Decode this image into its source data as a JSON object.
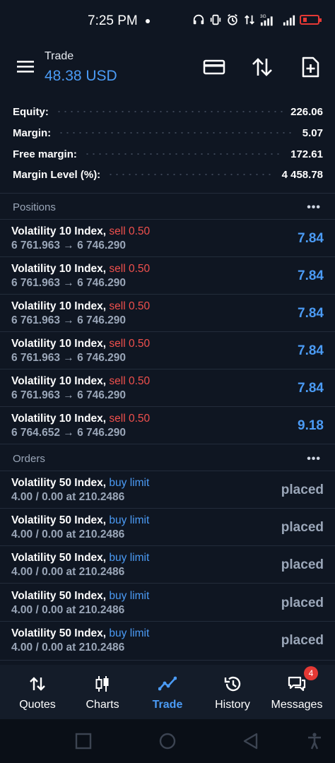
{
  "status_bar": {
    "time": "7:25 PM",
    "network": "3G",
    "battery_icon": "battery-low-icon"
  },
  "app_bar": {
    "title": "Trade",
    "balance": "48.38 USD"
  },
  "summary": {
    "rows": [
      {
        "label": "Equity:",
        "value": "226.06"
      },
      {
        "label": "Margin:",
        "value": "5.07"
      },
      {
        "label": "Free margin:",
        "value": "172.61"
      },
      {
        "label": "Margin Level (%):",
        "value": "4 458.78"
      }
    ]
  },
  "positions": {
    "header": "Positions",
    "more": "•••",
    "items": [
      {
        "symbol": "Volatility 10 Index,",
        "action": "sell 0.50",
        "prices": "6 761.963 → 6 746.290",
        "profit": "7.84"
      },
      {
        "symbol": "Volatility 10 Index,",
        "action": "sell 0.50",
        "prices": "6 761.963 → 6 746.290",
        "profit": "7.84"
      },
      {
        "symbol": "Volatility 10 Index,",
        "action": "sell 0.50",
        "prices": "6 761.963 → 6 746.290",
        "profit": "7.84"
      },
      {
        "symbol": "Volatility 10 Index,",
        "action": "sell 0.50",
        "prices": "6 761.963 → 6 746.290",
        "profit": "7.84"
      },
      {
        "symbol": "Volatility 10 Index,",
        "action": "sell 0.50",
        "prices": "6 761.963 → 6 746.290",
        "profit": "7.84"
      },
      {
        "symbol": "Volatility 10 Index,",
        "action": "sell 0.50",
        "prices": "6 764.652 → 6 746.290",
        "profit": "9.18"
      }
    ]
  },
  "orders": {
    "header": "Orders",
    "more": "•••",
    "items": [
      {
        "symbol": "Volatility 50 Index,",
        "action": "buy limit",
        "details": "4.00 / 0.00 at 210.2486",
        "state": "placed"
      },
      {
        "symbol": "Volatility 50 Index,",
        "action": "buy limit",
        "details": "4.00 / 0.00 at 210.2486",
        "state": "placed"
      },
      {
        "symbol": "Volatility 50 Index,",
        "action": "buy limit",
        "details": "4.00 / 0.00 at 210.2486",
        "state": "placed"
      },
      {
        "symbol": "Volatility 50 Index,",
        "action": "buy limit",
        "details": "4.00 / 0.00 at 210.2486",
        "state": "placed"
      },
      {
        "symbol": "Volatility 50 Index,",
        "action": "buy limit",
        "details": "4.00 / 0.00 at 210.2486",
        "state": "placed"
      }
    ]
  },
  "tabs": [
    {
      "label": "Quotes",
      "icon": "quotes-icon"
    },
    {
      "label": "Charts",
      "icon": "charts-icon"
    },
    {
      "label": "Trade",
      "icon": "trade-icon",
      "active": true
    },
    {
      "label": "History",
      "icon": "history-icon"
    },
    {
      "label": "Messages",
      "icon": "messages-icon",
      "badge": "4"
    }
  ],
  "colors": {
    "background": "#0f1622",
    "accent": "#4b9bf5",
    "sell": "#f0504d",
    "muted": "#9aa6b8"
  }
}
